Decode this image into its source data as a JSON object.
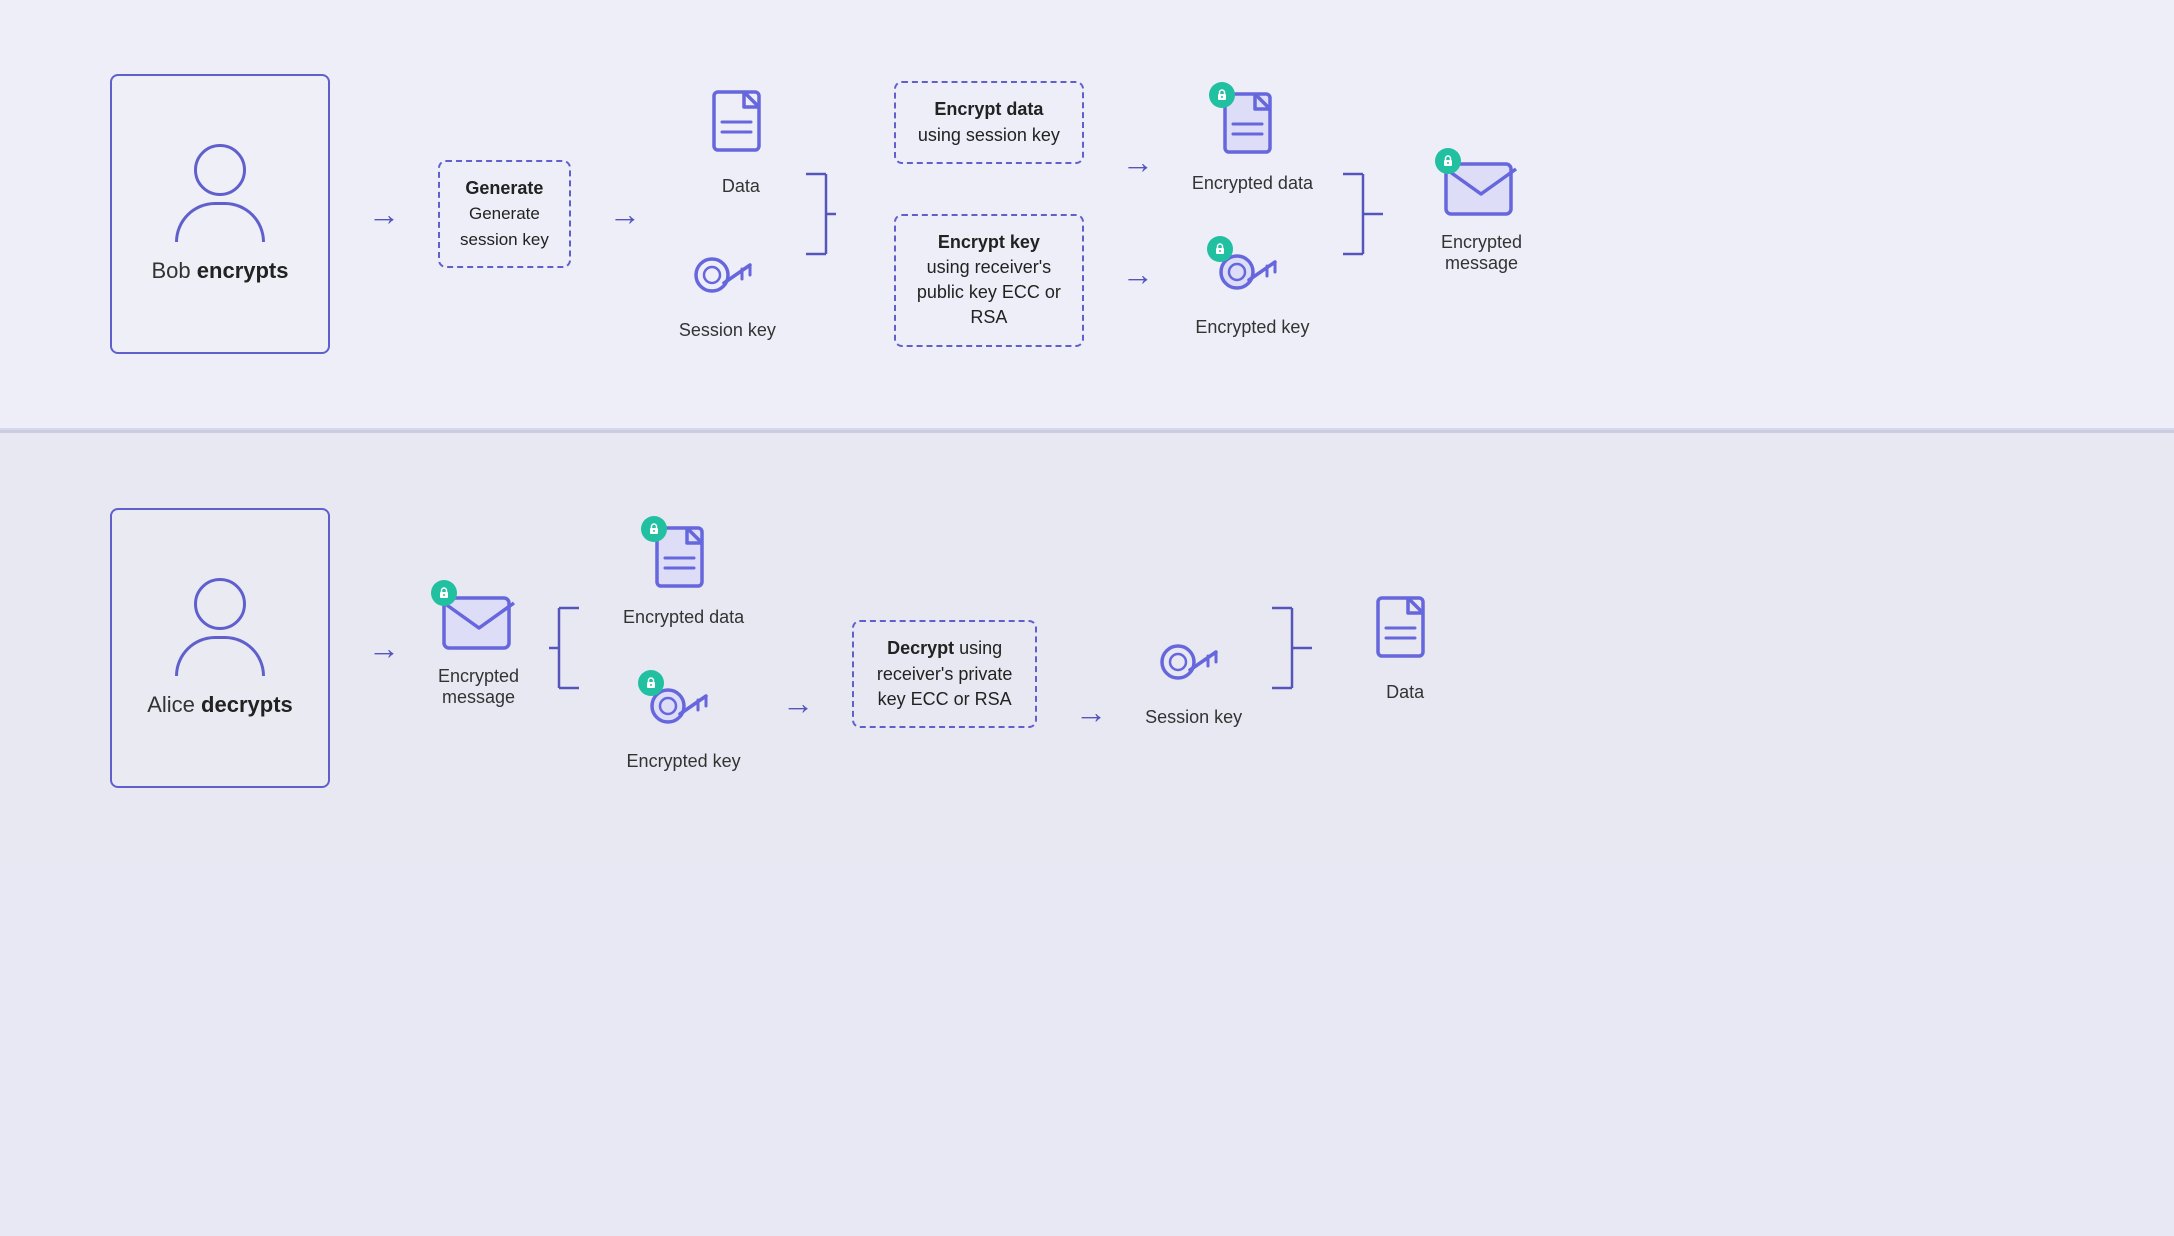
{
  "colors": {
    "background": "#eeeef8",
    "border": "#6060cc",
    "arrow": "#5555bb",
    "teal": "#20c0a0",
    "text": "#333",
    "icon_fill": "#6666dd",
    "icon_stroke": "#5555bb"
  },
  "top_section": {
    "actor_name": "Bob",
    "actor_action": "encrypts",
    "step1_label": "Generate\nsession key",
    "step2_data_label": "Data",
    "step2_key_label": "Session key",
    "step3_data_box": "Encrypt data using session key",
    "step3_key_box": "Encrypt key using receiver's public key ECC or RSA",
    "step4_data_label": "Encrypted data",
    "step4_key_label": "Encrypted key",
    "step5_label": "Encrypted\nmessage"
  },
  "bottom_section": {
    "actor_name": "Alice",
    "actor_action": "decrypts",
    "step1_label": "Encrypted\nmessage",
    "step2_data_label": "Encrypted data",
    "step2_key_label": "Encrypted key",
    "step3_key_box": "Decrypt using receiver's private key ECC or RSA",
    "step4_key_label": "Session key",
    "step5_label": "Data"
  }
}
